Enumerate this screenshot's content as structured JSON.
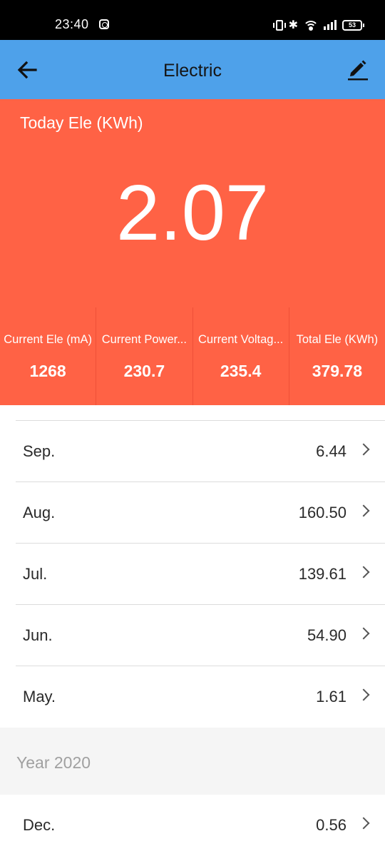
{
  "status_bar": {
    "time": "23:40",
    "battery": "53"
  },
  "app_bar": {
    "title": "Electric",
    "back_icon": "arrow-left-icon",
    "edit_icon": "pencil-icon"
  },
  "hero": {
    "label": "Today Ele (KWh)",
    "value": "2.07"
  },
  "stats": [
    {
      "label": "Current Ele (mA)",
      "value": "1268"
    },
    {
      "label": "Current Power...",
      "value": "230.7"
    },
    {
      "label": "Current Voltag...",
      "value": "235.4"
    },
    {
      "label": "Total Ele (KWh)",
      "value": "379.78"
    }
  ],
  "months": [
    {
      "label": "Sep.",
      "value": "6.44"
    },
    {
      "label": "Aug.",
      "value": "160.50"
    },
    {
      "label": "Jul.",
      "value": "139.61"
    },
    {
      "label": "Jun.",
      "value": "54.90"
    },
    {
      "label": "May.",
      "value": "1.61"
    }
  ],
  "section": {
    "title": "Year 2020"
  },
  "section_months": [
    {
      "label": "Dec.",
      "value": "0.56"
    }
  ],
  "colors": {
    "app_bar": "#4ea1ea",
    "accent": "#ff6245",
    "section_bg": "#f5f5f5"
  }
}
